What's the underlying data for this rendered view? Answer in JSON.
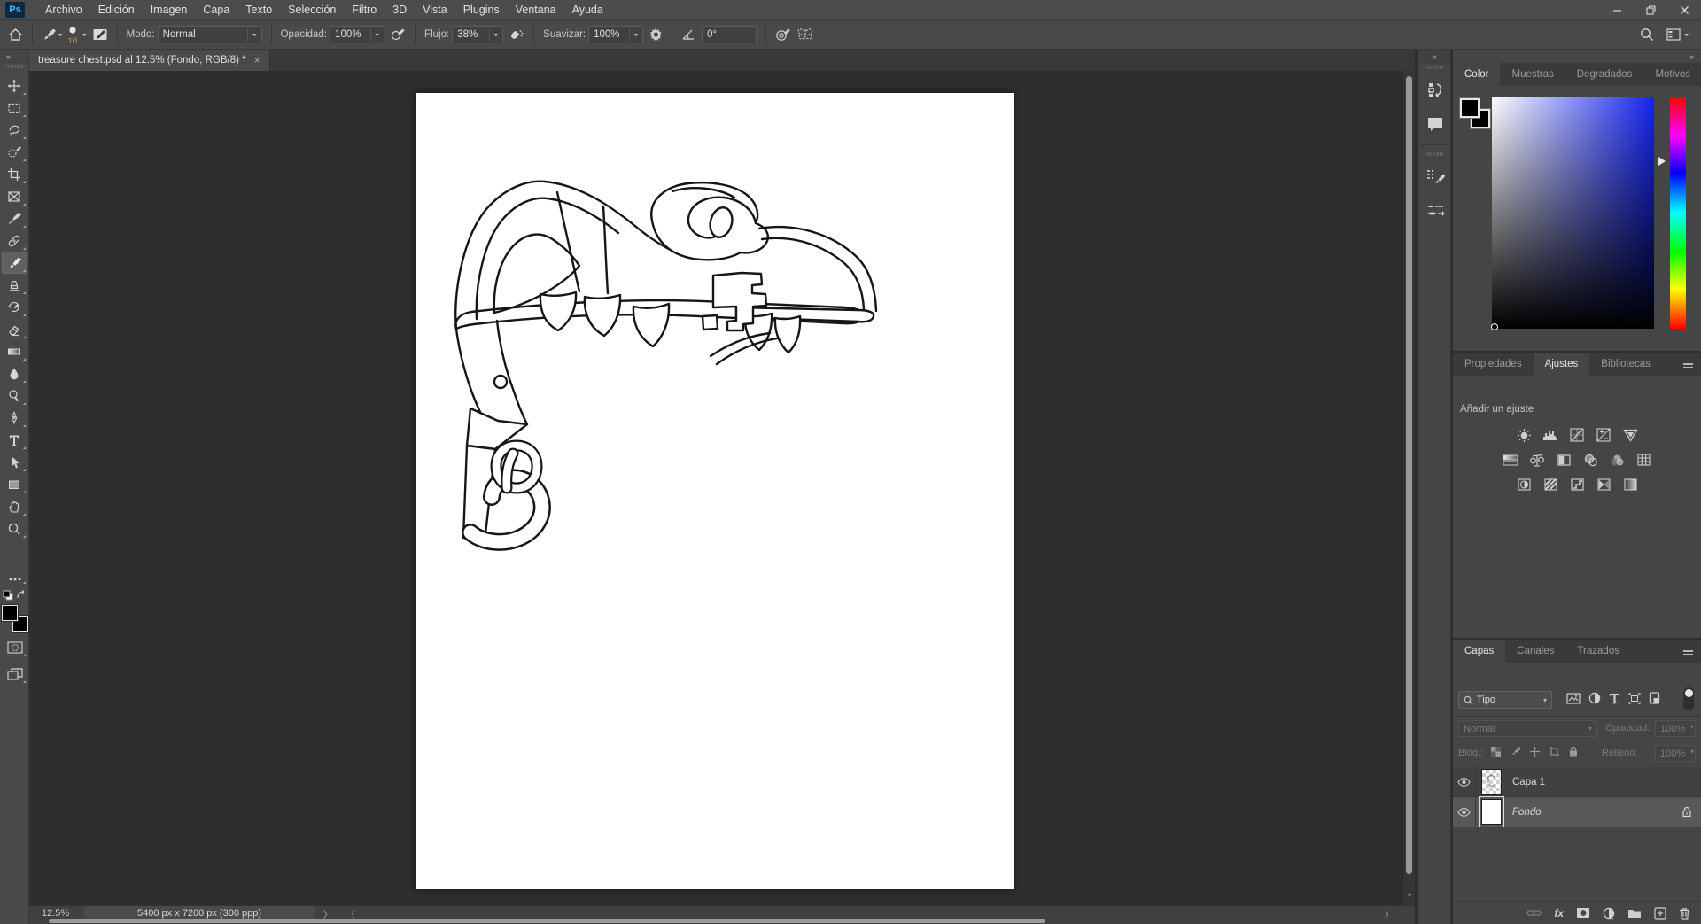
{
  "app": {
    "logo": "Ps"
  },
  "menubar": {
    "items": [
      "Archivo",
      "Edición",
      "Imagen",
      "Capa",
      "Texto",
      "Selección",
      "Filtro",
      "3D",
      "Vista",
      "Plugins",
      "Ventana",
      "Ayuda"
    ]
  },
  "options_bar": {
    "brush_size": "10",
    "modo_label": "Modo:",
    "modo_value": "Normal",
    "opacidad_label": "Opacidad:",
    "opacidad_value": "100%",
    "flujo_label": "Flujo:",
    "flujo_value": "38%",
    "suavizar_label": "Suavizar:",
    "suavizar_value": "100%",
    "angle_value": "0°"
  },
  "document_tab": {
    "title": "treasure chest.psd al 12.5% (Fondo, RGB/8) *",
    "close": "×"
  },
  "toolbar": {
    "tools": [
      "move",
      "rectangular-marquee",
      "lasso",
      "object-selection",
      "crop",
      "frame",
      "eyedropper",
      "spot-healing",
      "brush",
      "clone-stamp",
      "history-brush",
      "eraser",
      "gradient",
      "blur",
      "dodge",
      "pen",
      "type",
      "path-selection",
      "rectangle",
      "hand",
      "zoom"
    ],
    "selected_tool": "brush"
  },
  "color_panel": {
    "tabs": [
      "Color",
      "Muestras",
      "Degradados",
      "Motivos"
    ],
    "active_tab": "Color",
    "foreground": "#000000",
    "background": "#000000",
    "hue": "#1524f0"
  },
  "adjustments_panel": {
    "tabs": [
      "Propiedades",
      "Ajustes",
      "Bibliotecas"
    ],
    "active_tab": "Ajustes",
    "add_label": "Añadir un ajuste"
  },
  "layers_panel": {
    "tabs": [
      "Capas",
      "Canales",
      "Trazados"
    ],
    "active_tab": "Capas",
    "search_value": "Tipo",
    "blend_value": "Normal",
    "opacity_label": "Opacidad:",
    "opacity_value": "100%",
    "lock_label": "Bloq.:",
    "fill_label": "Relleno:",
    "fill_value": "100%",
    "layers": [
      {
        "name": "Capa 1",
        "visible": true,
        "selected": false
      },
      {
        "name": "Fondo",
        "visible": true,
        "selected": true,
        "locked": true
      }
    ]
  },
  "status_bar": {
    "zoom": "12.5%",
    "doc_info": "5400 px x 7200 px (300 ppp)"
  },
  "colors": {
    "ui_bg": "#494949",
    "pasteboard": "#2e2e2e",
    "panel": "#454545",
    "selection_row": "#585858",
    "logo_bg": "#0d2940",
    "logo_text": "#55b6ff"
  }
}
